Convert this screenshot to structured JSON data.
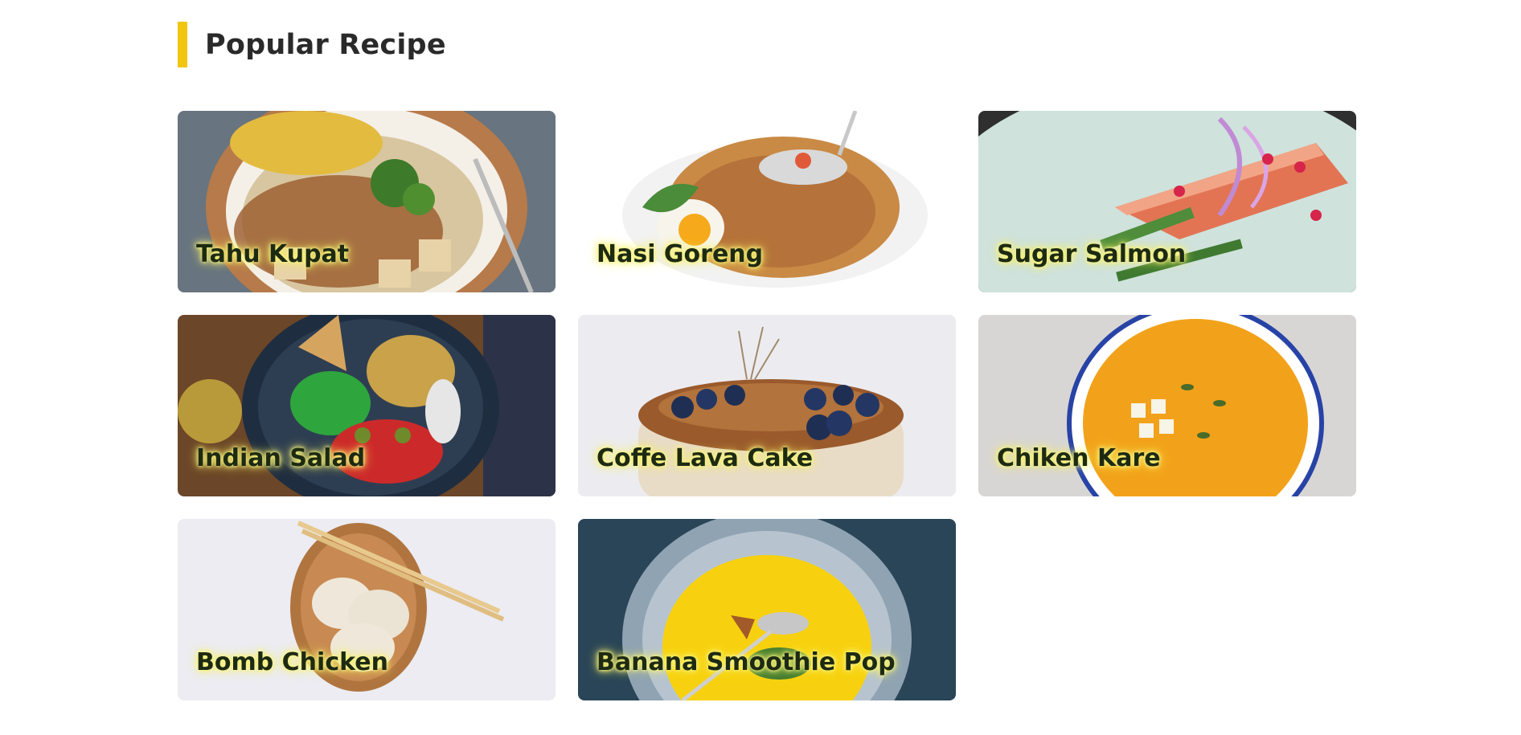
{
  "section": {
    "title": "Popular Recipe",
    "accent_color": "#f2c511"
  },
  "recipes": [
    {
      "title": "Tahu Kupat"
    },
    {
      "title": "Nasi Goreng"
    },
    {
      "title": "Sugar Salmon"
    },
    {
      "title": "Indian Salad"
    },
    {
      "title": "Coffe Lava Cake"
    },
    {
      "title": "Chiken Kare"
    },
    {
      "title": "Bomb Chicken"
    },
    {
      "title": "Banana Smoothie Pop"
    }
  ]
}
